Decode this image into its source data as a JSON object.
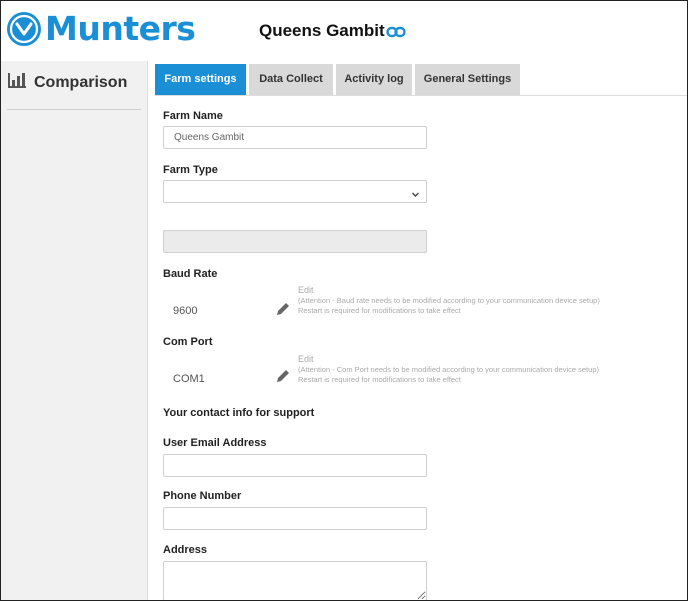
{
  "header": {
    "brand": "Munters",
    "farm_title": "Queens Gambit",
    "link_icon": "link-icon",
    "brand_color": "#1b8fd6"
  },
  "sidebar": {
    "comparison_label": "Comparison",
    "comparison_icon": "bar-chart-icon"
  },
  "tabs": [
    {
      "label": "Farm settings",
      "active": true
    },
    {
      "label": "Data Collect",
      "active": false
    },
    {
      "label": "Activity log",
      "active": false
    },
    {
      "label": "General Settings",
      "active": false
    }
  ],
  "form": {
    "farm_name_label": "Farm Name",
    "farm_name_value": "Queens Gambit",
    "farm_type_label": "Farm Type",
    "farm_type_value": "",
    "baud_rate_label": "Baud Rate",
    "baud_rate_value": "9600",
    "baud_edit": "Edit",
    "baud_note_1": "(Attention - Baud rate needs to be modified according to your communication device setup)",
    "baud_note_2": "Restart is required for modifications to take effect",
    "com_port_label": "Com Port",
    "com_port_value": "COM1",
    "com_edit": "Edit",
    "com_note_1": "(Attention - Com Port needs to be modified according to your communication device setup)",
    "com_note_2": "Restart is required for modifications to take effect",
    "contact_heading": "Your contact info for support",
    "email_label": "User Email Address",
    "email_value": "",
    "phone_label": "Phone Number",
    "phone_value": "",
    "address_label": "Address",
    "address_value": ""
  }
}
